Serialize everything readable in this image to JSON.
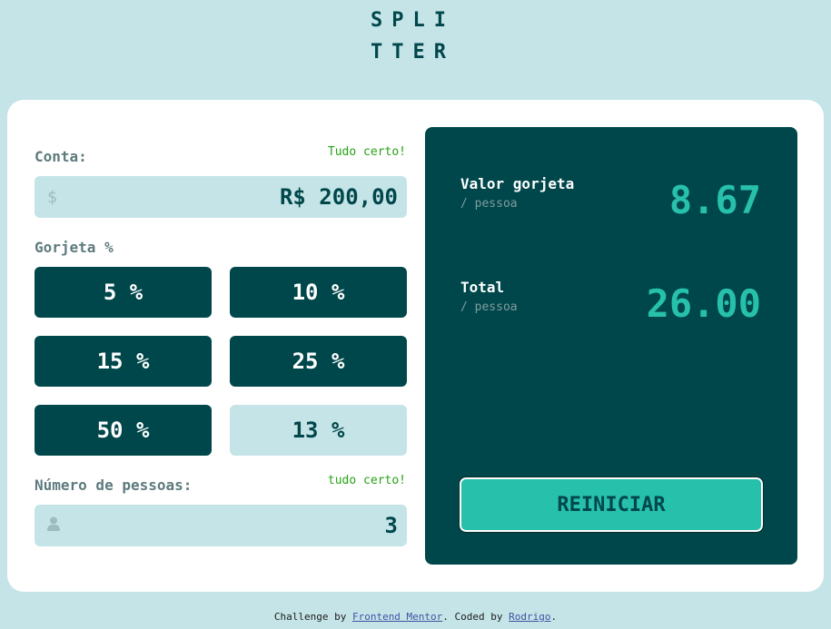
{
  "logo": {
    "line1": "SPLI",
    "line2": "TTER"
  },
  "bill": {
    "label": "Conta:",
    "status": "Tudo certo!",
    "icon": "dollar-icon",
    "icon_glyph": "$",
    "value": "R$ 200,00"
  },
  "tip": {
    "label": "Gorjeta %",
    "options": [
      "5 %",
      "10 %",
      "15 %",
      "25 %",
      "50 %",
      "13 %"
    ]
  },
  "people": {
    "label": "Número de pessoas:",
    "status": "tudo certo!",
    "icon": "person-icon",
    "value": "3"
  },
  "result": {
    "tip_label": "Valor gorjeta",
    "tip_sub": "/ pessoa",
    "tip_value": "8.67",
    "total_label": "Total",
    "total_sub": "/ pessoa",
    "total_value": "26.00",
    "reset_label": "REINICIAR"
  },
  "footer": {
    "prefix": "Challenge by ",
    "link1": "Frontend Mentor",
    "middle": ". Coded by ",
    "link2": "Rodrigo",
    "suffix": "."
  },
  "colors": {
    "background": "#c5e4e7",
    "dark_cyan": "#00474b",
    "accent": "#26c0ab",
    "ok_green": "#26a316"
  }
}
